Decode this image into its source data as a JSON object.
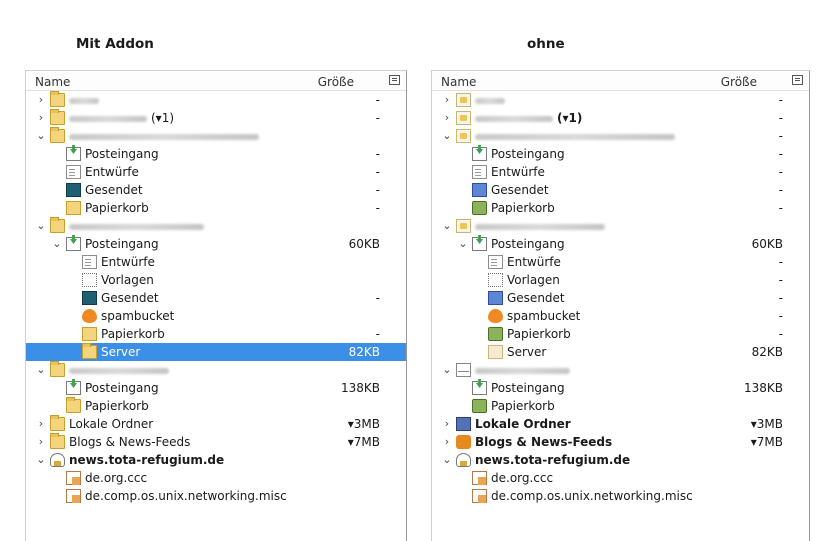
{
  "headings": {
    "left": "Mit Addon",
    "right": "ohne"
  },
  "columns": {
    "name": "Name",
    "size": "Größe"
  },
  "left": {
    "rows": [
      {
        "twisty": "›",
        "level": 0,
        "icon": "folder-icon",
        "label": "",
        "blur": 30,
        "size": "-"
      },
      {
        "twisty": "›",
        "level": 0,
        "icon": "folder-icon",
        "label": "(▾1)",
        "blur": 78,
        "size": "-"
      },
      {
        "twisty": "⌄",
        "level": 0,
        "icon": "folder-icon",
        "label": "",
        "blur": 190,
        "size": ""
      },
      {
        "twisty": "",
        "level": 1,
        "icon": "inbox-icon",
        "label": "Posteingang",
        "size": "-"
      },
      {
        "twisty": "",
        "level": 1,
        "icon": "draft-icon",
        "label": "Entwürfe",
        "size": "-"
      },
      {
        "twisty": "",
        "level": 1,
        "icon": "sent-icon",
        "label": "Gesendet",
        "size": "-"
      },
      {
        "twisty": "",
        "level": 1,
        "icon": "trash-icon",
        "label": "Papierkorb",
        "size": "-"
      },
      {
        "twisty": "⌄",
        "level": 0,
        "icon": "folder-icon",
        "label": "",
        "blur": 135,
        "size": ""
      },
      {
        "twisty": "⌄",
        "level": 1,
        "icon": "inbox-icon",
        "label": "Posteingang",
        "size": "60KB"
      },
      {
        "twisty": "",
        "level": 2,
        "icon": "draft-icon",
        "label": "Entwürfe",
        "size": ""
      },
      {
        "twisty": "",
        "level": 2,
        "icon": "template-icon",
        "label": "Vorlagen",
        "size": ""
      },
      {
        "twisty": "",
        "level": 2,
        "icon": "sent-icon",
        "label": "Gesendet",
        "size": "-"
      },
      {
        "twisty": "",
        "level": 2,
        "icon": "spam-icon",
        "label": "spambucket",
        "size": ""
      },
      {
        "twisty": "",
        "level": 2,
        "icon": "trash-icon",
        "label": "Papierkorb",
        "size": "-"
      },
      {
        "twisty": "",
        "level": 2,
        "icon": "folder-icon",
        "label": "Server",
        "size": "82KB",
        "selected": true
      },
      {
        "twisty": "⌄",
        "level": 0,
        "icon": "folder-icon",
        "label": "",
        "blur": 100,
        "size": ""
      },
      {
        "twisty": "",
        "level": 1,
        "icon": "inbox-icon",
        "label": "Posteingang",
        "size": "138KB"
      },
      {
        "twisty": "",
        "level": 1,
        "icon": "folder-icon",
        "label": "Papierkorb",
        "size": ""
      },
      {
        "twisty": "›",
        "level": 0,
        "icon": "folder-icon",
        "label": "Lokale Ordner",
        "size": "▾3MB"
      },
      {
        "twisty": "›",
        "level": 0,
        "icon": "folder-icon",
        "label": "Blogs & News-Feeds",
        "size": "▾7MB"
      },
      {
        "twisty": "⌄",
        "level": 0,
        "icon": "news-server-icon",
        "label": "news.tota-refugium.de",
        "bold": true,
        "size": ""
      },
      {
        "twisty": "",
        "level": 1,
        "icon": "newsgroup-icon",
        "label": "de.org.ccc",
        "size": ""
      },
      {
        "twisty": "",
        "level": 1,
        "icon": "newsgroup-icon",
        "label": "de.comp.os.unix.networking.misc",
        "size": ""
      }
    ]
  },
  "right": {
    "rows": [
      {
        "twisty": "›",
        "level": 0,
        "icon": "server-icon",
        "label": "",
        "blur": 30,
        "size": "-"
      },
      {
        "twisty": "›",
        "level": 0,
        "icon": "server-icon",
        "label": "(▾1)",
        "blur": 78,
        "bold": true,
        "size": "-"
      },
      {
        "twisty": "⌄",
        "level": 0,
        "icon": "server-icon",
        "label": "",
        "blur": 200,
        "size": "-"
      },
      {
        "twisty": "",
        "level": 1,
        "icon": "inbox-icon",
        "label": "Posteingang",
        "size": "-"
      },
      {
        "twisty": "",
        "level": 1,
        "icon": "draft-icon",
        "label": "Entwürfe",
        "size": "-"
      },
      {
        "twisty": "",
        "level": 1,
        "icon": "sent-icon",
        "label": "Gesendet",
        "size": "-"
      },
      {
        "twisty": "",
        "level": 1,
        "icon": "trash-icon",
        "label": "Papierkorb",
        "size": "-"
      },
      {
        "twisty": "⌄",
        "level": 0,
        "icon": "server-icon",
        "label": "",
        "blur": 130,
        "size": ""
      },
      {
        "twisty": "⌄",
        "level": 1,
        "icon": "inbox-icon",
        "label": "Posteingang",
        "size": "60KB"
      },
      {
        "twisty": "",
        "level": 2,
        "icon": "draft-icon",
        "label": "Entwürfe",
        "size": "-"
      },
      {
        "twisty": "",
        "level": 2,
        "icon": "template-icon",
        "label": "Vorlagen",
        "size": "-"
      },
      {
        "twisty": "",
        "level": 2,
        "icon": "sent-icon",
        "label": "Gesendet",
        "size": "-"
      },
      {
        "twisty": "",
        "level": 2,
        "icon": "spam-icon",
        "label": "spambucket",
        "size": "-"
      },
      {
        "twisty": "",
        "level": 2,
        "icon": "trash-icon",
        "label": "Papierkorb",
        "size": "-"
      },
      {
        "twisty": "",
        "level": 2,
        "icon": "folder-icon",
        "label": "Server",
        "size": "82KB"
      },
      {
        "twisty": "⌄",
        "level": 0,
        "icon": "envelope-icon",
        "label": "",
        "blur": 95,
        "size": ""
      },
      {
        "twisty": "",
        "level": 1,
        "icon": "inbox-icon",
        "label": "Posteingang",
        "size": "138KB"
      },
      {
        "twisty": "",
        "level": 1,
        "icon": "trash-icon",
        "label": "Papierkorb",
        "size": ""
      },
      {
        "twisty": "›",
        "level": 0,
        "icon": "local-folders-icon",
        "label": "Lokale Ordner",
        "bold": true,
        "size": "▾3MB"
      },
      {
        "twisty": "›",
        "level": 0,
        "icon": "rss-icon",
        "label": "Blogs & News-Feeds",
        "bold": true,
        "size": "▾7MB"
      },
      {
        "twisty": "⌄",
        "level": 0,
        "icon": "news-server-icon",
        "label": "news.tota-refugium.de",
        "bold": true,
        "size": ""
      },
      {
        "twisty": "",
        "level": 1,
        "icon": "newsgroup-icon",
        "label": "de.org.ccc",
        "size": ""
      },
      {
        "twisty": "",
        "level": 1,
        "icon": "newsgroup-icon",
        "label": "de.comp.os.unix.networking.misc",
        "size": ""
      }
    ]
  }
}
